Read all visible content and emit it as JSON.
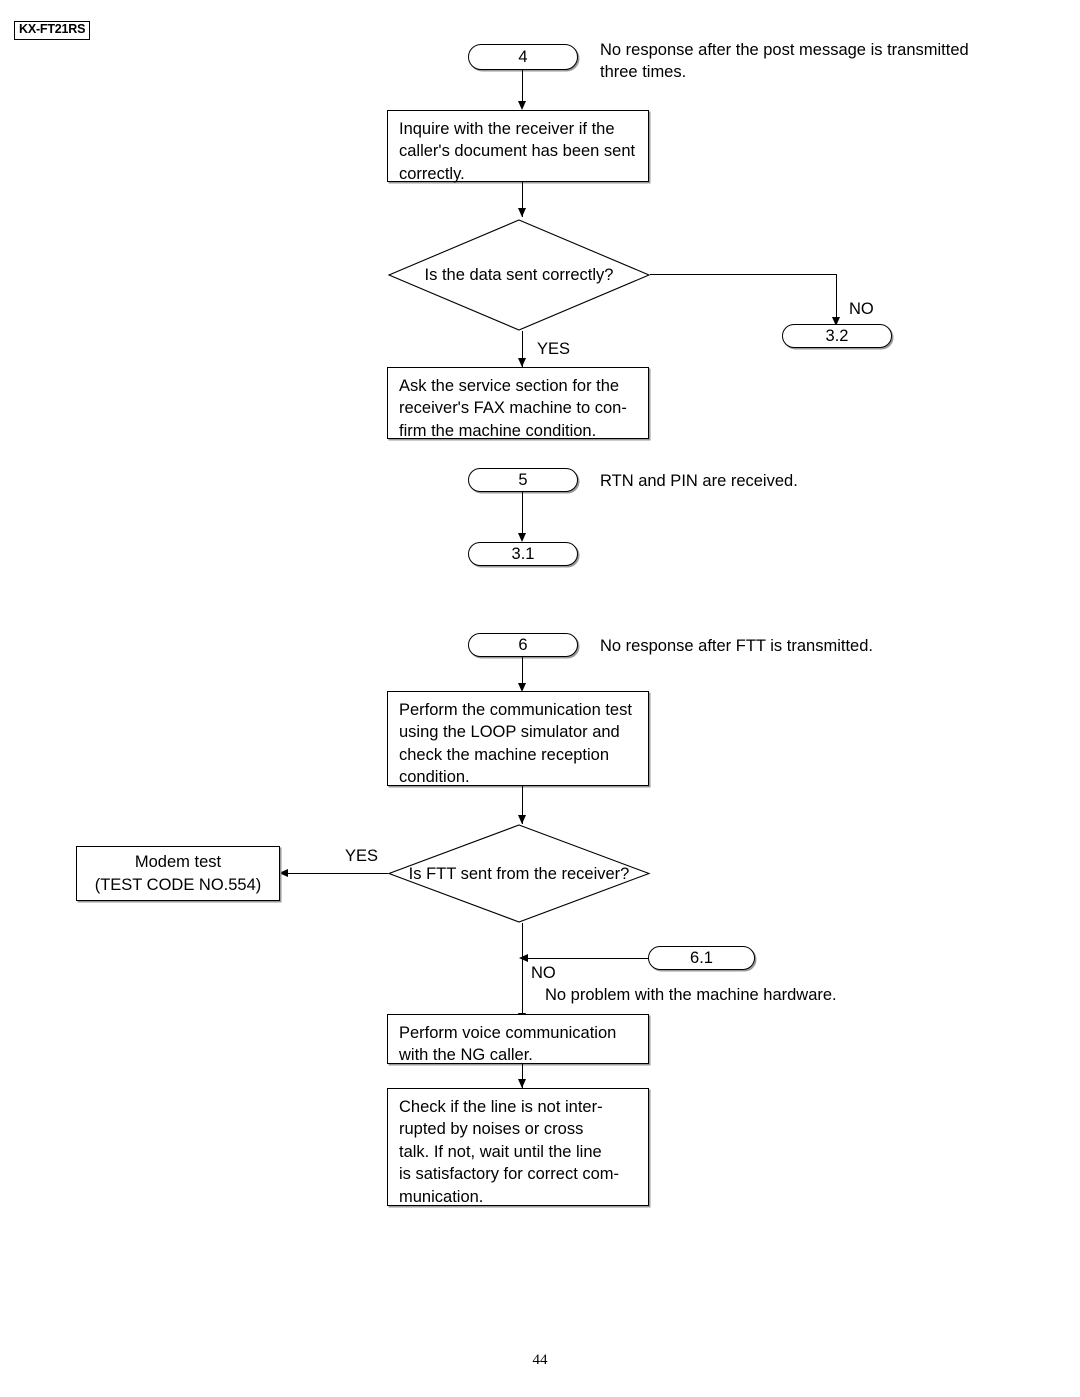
{
  "document": {
    "model": "KX-FT21RS",
    "page_number": "44"
  },
  "sections": {
    "s4": {
      "connector": "4",
      "caption": "No response after the post message is transmitted\nthree times.",
      "process1": "Inquire with the receiver if the\ncaller's document has been sent\ncorrectly.",
      "decision": "Is the data sent correctly?",
      "yes_label": "YES",
      "no_label": "NO",
      "no_target": "3.2",
      "process2": "Ask the service section for the\nreceiver's FAX machine to con-\nfirm the machine condition."
    },
    "s5": {
      "connector": "5",
      "caption": "RTN and PIN are received.",
      "target": "3.1"
    },
    "s6": {
      "connector": "6",
      "caption": "No response after FTT is transmitted.",
      "process1": "Perform the communication test\nusing the LOOP simulator and\ncheck the machine reception\ncondition.",
      "decision": "Is FTT sent from the receiver?",
      "yes_label": "YES",
      "no_label": "NO",
      "modem_test_line1": "Modem test",
      "modem_test_line2": "(TEST CODE NO.554)",
      "connector_61": "6.1",
      "caption_61": "No problem with the machine hardware.",
      "process2": "Perform voice communication\nwith the NG caller.",
      "process3": "Check if the line is not inter-\nrupted by noises or cross\ntalk. If not, wait until the line\nis satisfactory for correct com-\nmunication."
    }
  }
}
